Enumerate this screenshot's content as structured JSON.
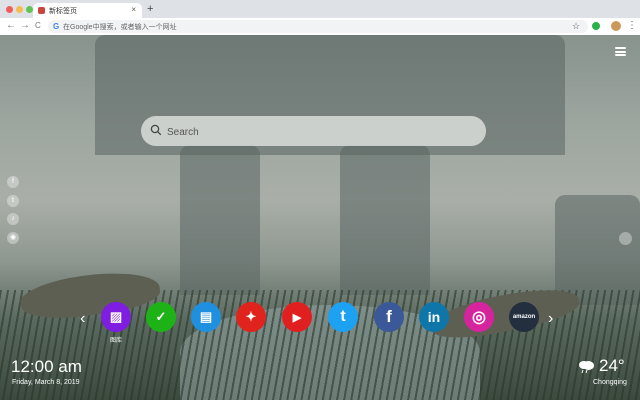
{
  "browser": {
    "tab_title": "新标签页",
    "tab_close": "×",
    "new_tab": "+",
    "address_placeholder": "在Google中搜索，或者输入一个网址",
    "nav": {
      "back": "←",
      "forward": "→",
      "reload": "C"
    },
    "star": "☆",
    "menu": "⋮"
  },
  "search": {
    "placeholder": "Search"
  },
  "sidebar": {
    "icons": [
      "facebook-icon",
      "twitter-icon",
      "music-icon",
      "camera-icon"
    ]
  },
  "shortcuts": {
    "prev": "‹",
    "next": "›",
    "items": [
      {
        "name": "gallery",
        "label": "图库",
        "color": "#7f1de0",
        "glyph": "▨"
      },
      {
        "name": "tasks",
        "label": "",
        "color": "#1db317",
        "glyph": "✓"
      },
      {
        "name": "notes",
        "label": "",
        "color": "#1f8fe0",
        "glyph": "▤"
      },
      {
        "name": "games",
        "label": "",
        "color": "#e0231d",
        "glyph": "✦"
      },
      {
        "name": "youtube",
        "label": "",
        "color": "#e02020",
        "glyph": "▶"
      },
      {
        "name": "twitter",
        "label": "",
        "color": "#1da1f2",
        "glyph": "t"
      },
      {
        "name": "facebook",
        "label": "",
        "color": "#3b5998",
        "glyph": "f"
      },
      {
        "name": "linkedin",
        "label": "",
        "color": "#0e76a8",
        "glyph": "in"
      },
      {
        "name": "instagram",
        "label": "",
        "color": "#d6249f",
        "glyph": "◎"
      },
      {
        "name": "amazon",
        "label": "",
        "color": "#232f3e",
        "glyph": "amazon"
      }
    ]
  },
  "clock": {
    "time": "12:00 am",
    "date": "Friday, March 8, 2019"
  },
  "weather": {
    "temp": "24°",
    "city": "Chongqing",
    "icon": "cloud-rain-icon"
  }
}
